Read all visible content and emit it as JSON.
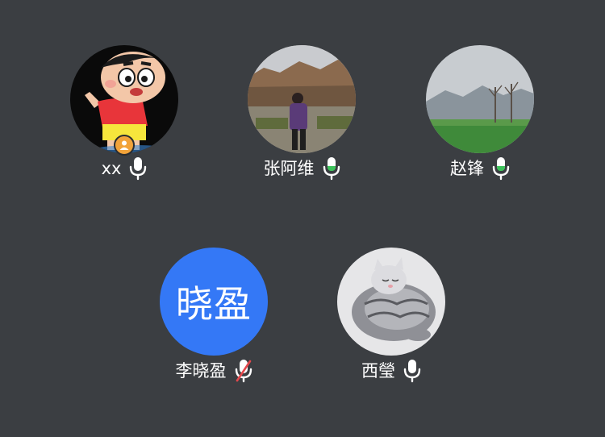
{
  "participants": [
    {
      "name": "xx",
      "avatar": "cartoon-boy-photo",
      "mic": "on",
      "host": true
    },
    {
      "name": "张阿维",
      "avatar": "person-photo",
      "mic": "on-active"
    },
    {
      "name": "赵锋",
      "avatar": "landscape-photo",
      "mic": "on-active"
    },
    {
      "name": "李晓盈",
      "avatar_text": "晓盈",
      "mic": "muted"
    },
    {
      "name": "西瑩",
      "avatar": "cat-photo",
      "mic": "on"
    }
  ],
  "colors": {
    "background": "#3b3e42",
    "text_avatar_bg": "#3478f6",
    "host_badge": "#f2a33a",
    "mic_active": "#3cc35a",
    "mic_muted_slash": "#e5484d"
  }
}
